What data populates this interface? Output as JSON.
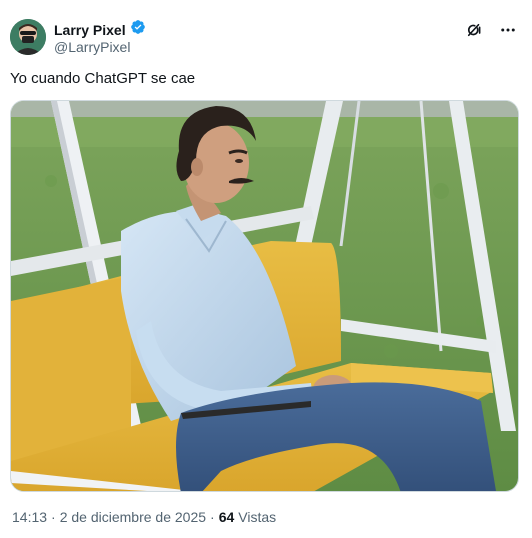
{
  "author": {
    "display_name": "Larry Pixel",
    "handle": "@LarryPixel",
    "verified": true
  },
  "tweet": {
    "text": "Yo cuando ChatGPT se cae"
  },
  "meta": {
    "time": "14:13",
    "separator_1": "·",
    "date": "2 de diciembre de 2025",
    "separator_2": "·",
    "views_count": "64",
    "views_label": "Vistas"
  },
  "icons": {
    "verified": "verified-badge-icon",
    "grok": "grok-icon",
    "more": "more-icon"
  },
  "colors": {
    "verified_blue": "#1d9bf0",
    "text_primary": "#0f1419",
    "text_secondary": "#536471"
  }
}
